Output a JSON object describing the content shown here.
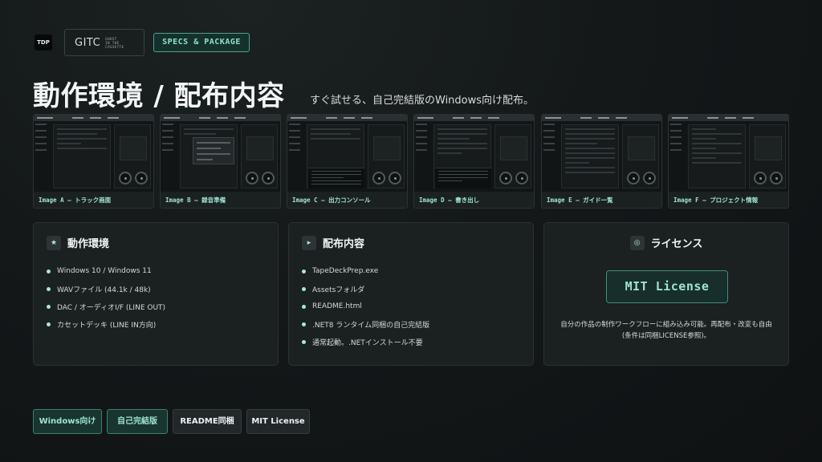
{
  "header": {
    "badge": "TDP",
    "logo_word": "GITC",
    "logo_sub": [
      "GHOST",
      "IN THE",
      "CASSETTE"
    ],
    "section_tag": "SPECS & PACKAGE"
  },
  "title": "動作環境 / 配布内容",
  "subtitle": "すぐ試せる、自己完結版のWindows向け配布。",
  "screenshots": [
    {
      "label": "Image A — トラック画面"
    },
    {
      "label": "Image B — 録音準備"
    },
    {
      "label": "Image C — 出力コンソール"
    },
    {
      "label": "Image D — 書き出し"
    },
    {
      "label": "Image E — ガイド一覧"
    },
    {
      "label": "Image F — プロジェクト情報"
    }
  ],
  "cards": {
    "requirements": {
      "icon": "★",
      "title": "動作環境",
      "items": [
        "Windows 10 / Windows 11",
        "WAVファイル (44.1k / 48k)",
        "DAC / オーディオI/F (LINE OUT)",
        "カセットデッキ (LINE IN方向)"
      ]
    },
    "contents": {
      "icon": "▸",
      "title": "配布内容",
      "items": [
        "TapeDeckPrep.exe",
        "Assetsフォルダ",
        "README.html",
        ".NET8 ランタイム同梱の自己完結版",
        "通常起動。.NETインストール不要"
      ]
    },
    "license": {
      "icon": "◎",
      "title": "ライセンス",
      "badge": "MIT License",
      "description": "自分の作品の制作ワークフローに組み込み可能。再配布・改変も自由 (条件は同梱LICENSE参照)。"
    }
  },
  "tags": [
    "Windows向け",
    "自己完結版",
    "README同梱",
    "MIT License"
  ],
  "colors": {
    "background": "#141819",
    "accent": "#9fe3d1",
    "card": "#1b2021"
  }
}
